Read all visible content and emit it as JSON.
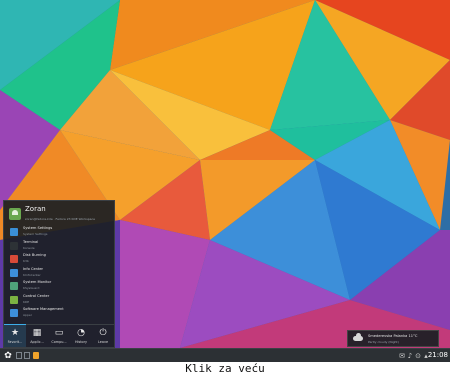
{
  "launcher": {
    "user_name": "Zoran",
    "user_host": "zoran@fedora-kde · Fedora 23 KDE Workspace",
    "apps": [
      {
        "name": "System Settings",
        "desc": "System Settings",
        "icon": "settings-icon",
        "color": "#3a8fd6"
      },
      {
        "name": "Terminal",
        "desc": "Konsole",
        "icon": "terminal-icon",
        "color": "#2d3236"
      },
      {
        "name": "Disk Burning",
        "desc": "K3b",
        "icon": "disc-icon",
        "color": "#d94a38"
      },
      {
        "name": "Info Center",
        "desc": "KInfoCenter",
        "icon": "info-icon",
        "color": "#3d8fd9"
      },
      {
        "name": "System Monitor",
        "desc": "KSysGuard",
        "icon": "monitor-icon",
        "color": "#4fa37b"
      },
      {
        "name": "Control Center",
        "desc": "KDE",
        "icon": "control-icon",
        "color": "#7cb342"
      },
      {
        "name": "Software Management",
        "desc": "Apper",
        "icon": "package-icon",
        "color": "#3d8fd9"
      }
    ],
    "tabs": [
      {
        "label": "Favorit...",
        "glyph": "★",
        "icon": "star-icon"
      },
      {
        "label": "Applic...",
        "glyph": "▦",
        "icon": "grid-icon"
      },
      {
        "label": "Compu...",
        "glyph": "▭",
        "icon": "computer-icon"
      },
      {
        "label": "History",
        "glyph": "◔",
        "icon": "clock-icon"
      },
      {
        "label": "Leave",
        "glyph": "⏻",
        "icon": "leave-icon"
      }
    ]
  },
  "notification": {
    "title": "Smederevska Palanka 11°C",
    "subtitle": "Partly cloudy (Night)"
  },
  "panel": {
    "clock": "21:08",
    "kicker_glyph": "✿",
    "tray": [
      {
        "glyph": "✉",
        "icon": "mail-icon"
      },
      {
        "glyph": "♪",
        "icon": "volume-icon"
      },
      {
        "glyph": "⊙",
        "icon": "network-icon"
      },
      {
        "glyph": "▴",
        "icon": "tray-expand-icon"
      }
    ]
  },
  "caption": "Klik za veću"
}
